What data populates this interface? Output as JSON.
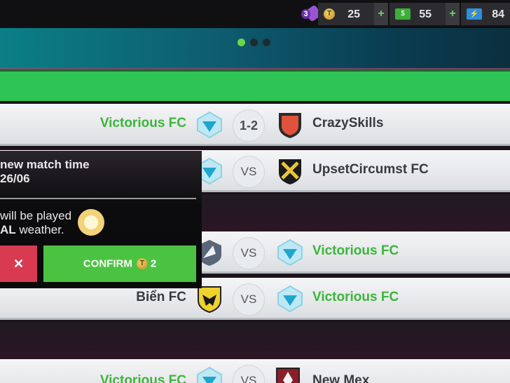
{
  "topbar": {
    "badge_count": "3",
    "coins": "25",
    "cash": "55",
    "energy": "84",
    "coin_icon": "T",
    "plus": "+"
  },
  "carousel": {
    "dots": 3,
    "active": 0
  },
  "matches": [
    {
      "home": "Victorious FC",
      "score": "1-2",
      "away": "CrazySkills"
    },
    {
      "home": "",
      "score": "VS",
      "away": "UpsetCircumst FC"
    },
    {
      "home": "",
      "score": "VS",
      "away": "Victorious FC"
    },
    {
      "home": "Biển FC",
      "score": "VS",
      "away": "Victorious FC"
    },
    {
      "home": "Victorious FC",
      "score": "VS",
      "away": "New Mex"
    }
  ],
  "popup": {
    "title": "new match time",
    "date": "26/06",
    "line1": "will be played",
    "line2_bold": "AL",
    "line2_rest": " weather.",
    "cancel_label": "✕",
    "confirm_label": "CONFIRM",
    "confirm_cost": "2"
  },
  "colors": {
    "green_text": "#3db53b",
    "confirm": "#4cc243",
    "cancel": "#d83a52",
    "banner": "#0e5a6e"
  }
}
